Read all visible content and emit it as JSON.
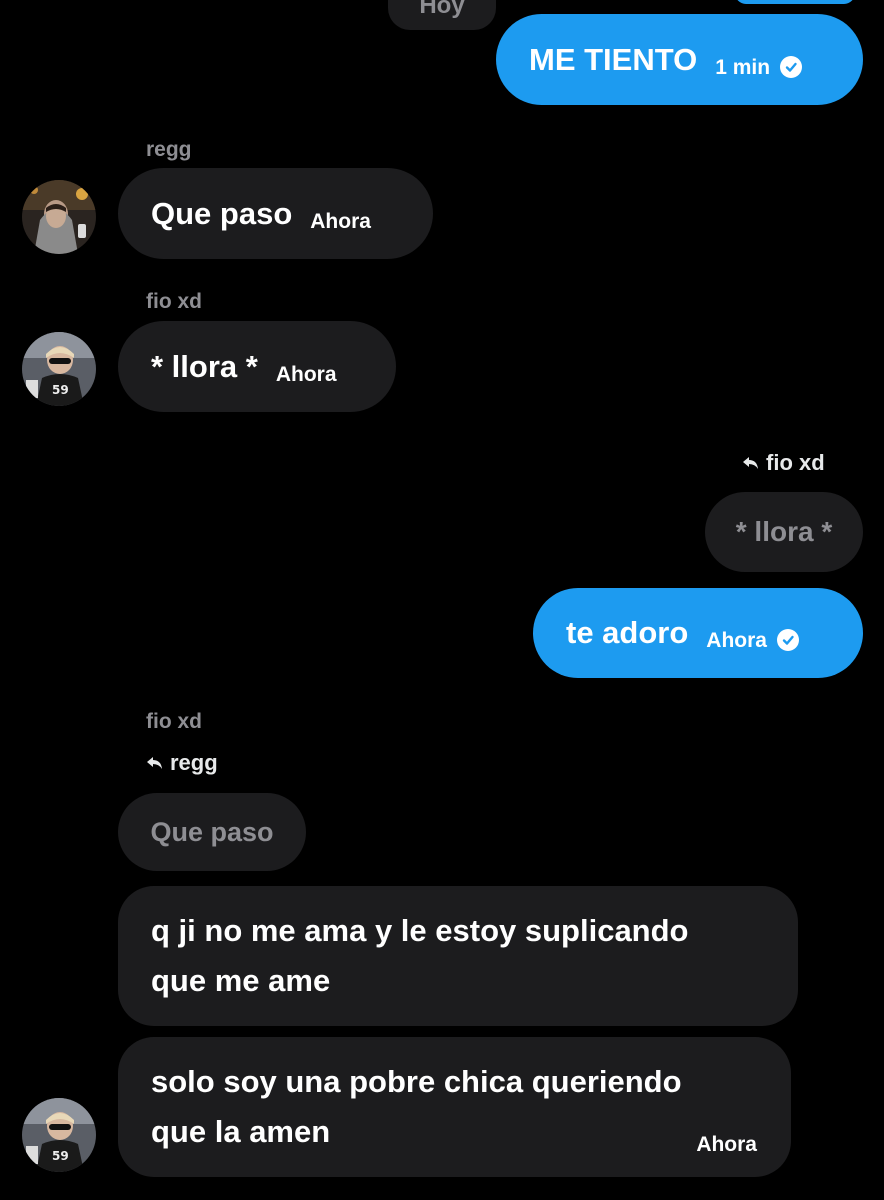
{
  "date_divider": "Hoy",
  "messages": {
    "m1": {
      "text": "ME TIENTO",
      "time": "1 min"
    },
    "m2": {
      "sender": "regg",
      "text": "Que paso",
      "time": "Ahora"
    },
    "m3": {
      "sender": "fio xd",
      "text": "* llora *",
      "time": "Ahora"
    },
    "m4": {
      "reply_to": "fio xd",
      "quoted": "* llora *",
      "text": "te adoro",
      "time": "Ahora"
    },
    "m5": {
      "sender": "fio xd",
      "reply_to": "regg",
      "quoted": "Que paso",
      "line1": "q ji no me ama y le estoy suplicando",
      "line2": "que me ame"
    },
    "m6": {
      "line1": "solo soy una pobre chica queriendo",
      "line2": "que la amen",
      "time": "Ahora"
    }
  },
  "icons": [
    "reply-icon",
    "read-check-icon",
    "avatar-regg",
    "avatar-fio"
  ],
  "colors": {
    "sent_bubble": "#1d9bf0",
    "received_bubble": "#1c1c1e",
    "muted_text": "#8e8e93"
  }
}
